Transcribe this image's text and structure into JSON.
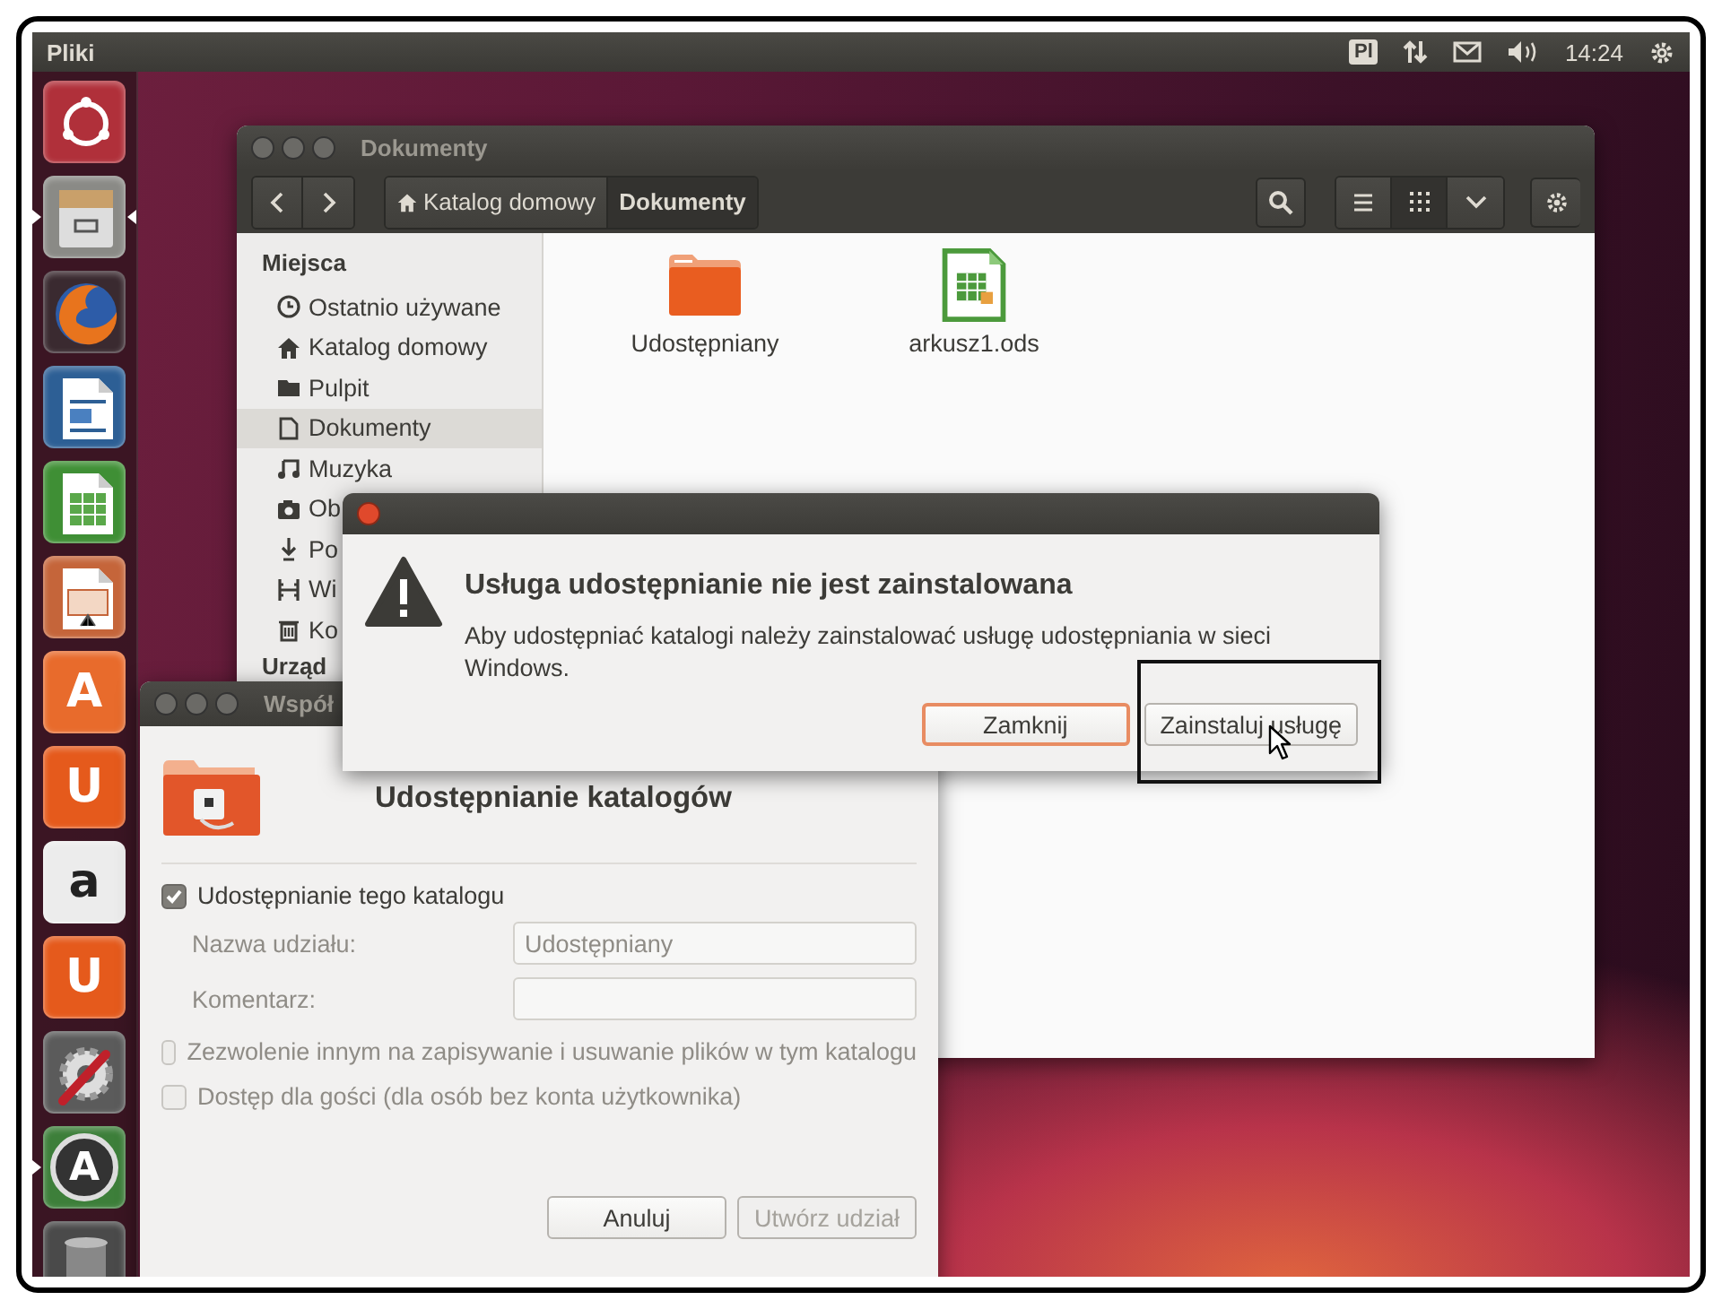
{
  "top_panel": {
    "app_name": "Pliki",
    "keyboard_layout": "Pl",
    "clock": "14:24"
  },
  "launcher": [
    {
      "kind": "dash",
      "running": false,
      "focused": false
    },
    {
      "kind": "files",
      "running": true,
      "focused": true
    },
    {
      "kind": "browser",
      "running": false,
      "focused": false
    },
    {
      "kind": "writer",
      "running": false,
      "focused": false
    },
    {
      "kind": "calc",
      "running": false,
      "focused": false
    },
    {
      "kind": "impress",
      "running": false,
      "focused": false
    },
    {
      "kind": "software",
      "glyph": "A",
      "running": false,
      "focused": false
    },
    {
      "kind": "cloud",
      "glyph": "U",
      "running": false,
      "focused": false
    },
    {
      "kind": "shop",
      "glyph": "a",
      "running": false,
      "focused": false
    },
    {
      "kind": "music",
      "glyph": "U",
      "running": false,
      "focused": false
    },
    {
      "kind": "settings",
      "running": false,
      "focused": false
    },
    {
      "kind": "updater",
      "glyph": "A",
      "running": true,
      "focused": false
    },
    {
      "kind": "trash",
      "running": false,
      "focused": false
    }
  ],
  "file_manager": {
    "title": "Dokumenty",
    "breadcrumbs": [
      {
        "label": "Katalog domowy",
        "kind": "home",
        "selected": false
      },
      {
        "label": "Dokumenty",
        "kind": "folder",
        "selected": true
      }
    ],
    "view_buttons": [
      {
        "kind": "list",
        "selected": false
      },
      {
        "kind": "grid",
        "selected": true
      }
    ],
    "sidebar": [
      {
        "heading": "Miejsca",
        "items": [
          {
            "label": "Ostatnio używane",
            "kind": "recent",
            "selected": false
          },
          {
            "label": "Katalog domowy",
            "kind": "home",
            "selected": false
          },
          {
            "label": "Pulpit",
            "kind": "desktop",
            "selected": false
          },
          {
            "label": "Dokumenty",
            "kind": "documents",
            "selected": true
          },
          {
            "label": "Muzyka",
            "kind": "music",
            "selected": false
          },
          {
            "label": "Ob",
            "kind": "pictures",
            "selected": false
          },
          {
            "label": "Po",
            "kind": "downloads",
            "selected": false
          },
          {
            "label": "Wi",
            "kind": "videos",
            "selected": false
          },
          {
            "label": "Ko",
            "kind": "trash",
            "selected": false
          }
        ]
      },
      {
        "heading": "Urząd"
      }
    ],
    "files": [
      {
        "name": "Udostępniany",
        "kind": "folder"
      },
      {
        "name": "arkusz1.ods",
        "kind": "spreadsheet"
      }
    ]
  },
  "alert": {
    "title": "Usługa udostępnianie nie jest zainstalowana",
    "message": "Aby udostępniać katalogi należy zainstalować usługę udostępniania w sieci Windows.",
    "buttons": [
      {
        "label": "Zamknij",
        "default": true
      },
      {
        "label": "Zainstaluj usługę",
        "default": false
      }
    ]
  },
  "sharing_window": {
    "title": "Współ",
    "heading": "Udostępnianie katalogów",
    "share_checkbox": {
      "label": "Udostępnianie tego katalogu",
      "checked": true,
      "disabled": false
    },
    "fields": [
      {
        "label": "Nazwa udziału:",
        "value": "Udostępniany"
      },
      {
        "label": "Komentarz:"
      }
    ],
    "options": [
      {
        "label": "Zezwolenie innym na zapisywanie i usuwanie plików w tym katalogu",
        "checked": false,
        "disabled": true
      },
      {
        "label": "Dostęp dla gości (dla osób bez konta użytkownika)",
        "checked": false,
        "disabled": true
      }
    ],
    "buttons": [
      {
        "label": "Anuluj",
        "disabled": false
      },
      {
        "label": "Utwórz udział",
        "disabled": true
      }
    ]
  }
}
